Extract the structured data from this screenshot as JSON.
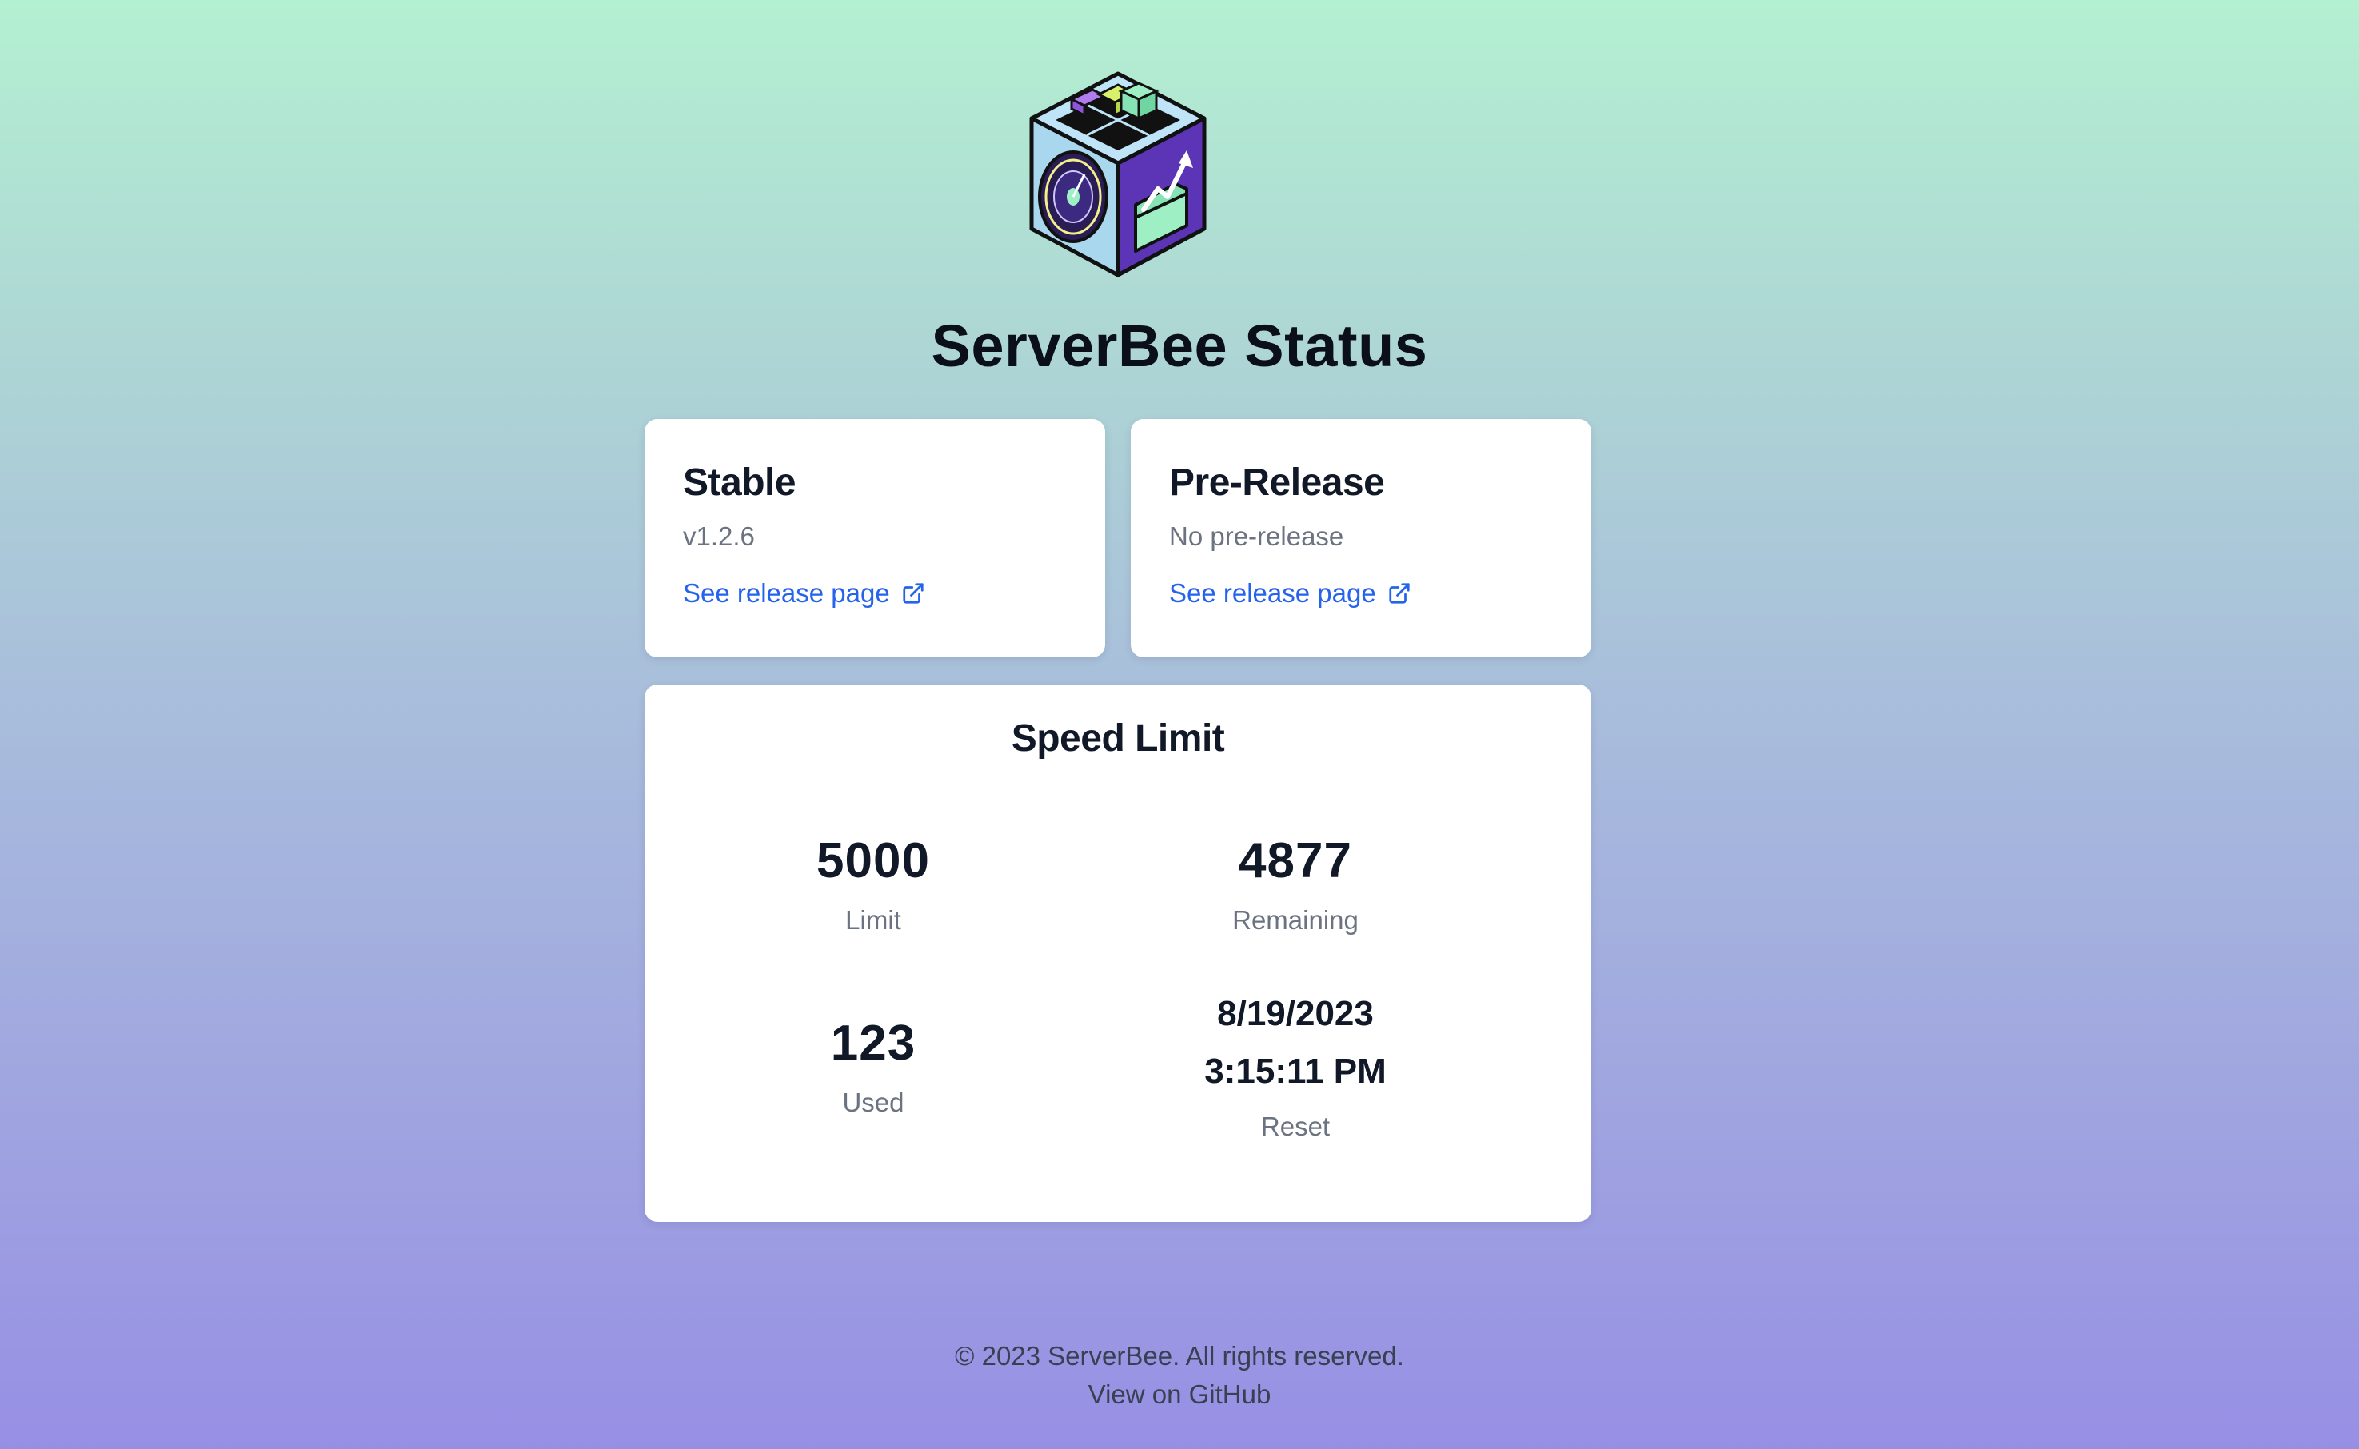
{
  "header": {
    "title": "ServerBee Status"
  },
  "cards": {
    "stable": {
      "heading": "Stable",
      "version": "v1.2.6",
      "link_label": "See release page"
    },
    "prerelease": {
      "heading": "Pre-Release",
      "version": "No pre-release",
      "link_label": "See release page"
    }
  },
  "speed_limit": {
    "title": "Speed Limit",
    "limit": {
      "value": "5000",
      "label": "Limit"
    },
    "remaining": {
      "value": "4877",
      "label": "Remaining"
    },
    "used": {
      "value": "123",
      "label": "Used"
    },
    "reset": {
      "date": "8/19/2023",
      "time": "3:15:11 PM",
      "label": "Reset"
    }
  },
  "footer": {
    "copyright": "© 2023 ServerBee. All rights reserved.",
    "github_label": "View on GitHub"
  },
  "colors": {
    "link": "#2563eb",
    "muted_text": "#6b7280",
    "heading_text": "#111827",
    "gradient_top": "#b4f0d2",
    "gradient_bottom": "#978fe4"
  },
  "icons": {
    "logo": "cube-logo-icon",
    "external_link": "external-link-icon"
  }
}
